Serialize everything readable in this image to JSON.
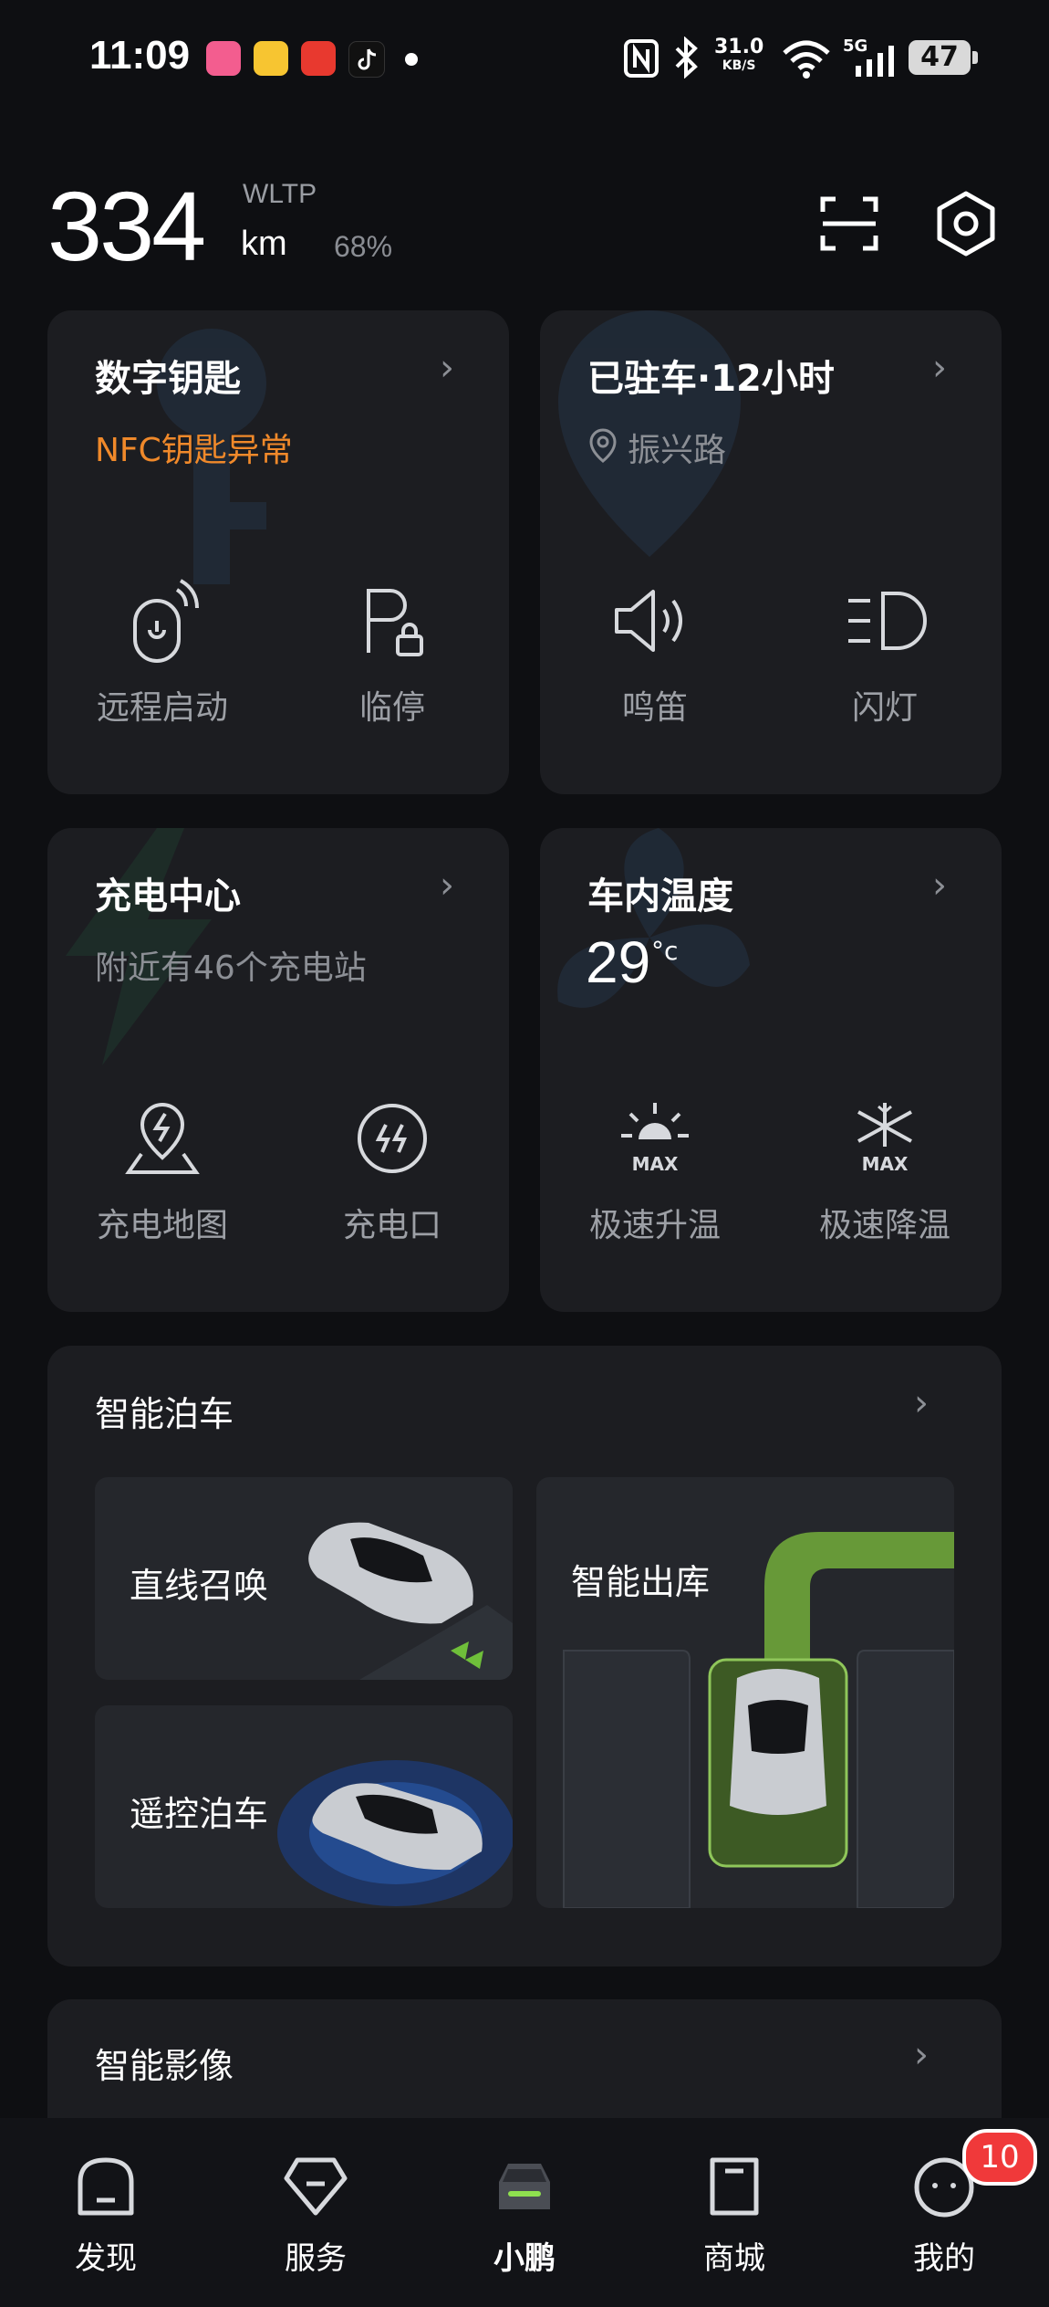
{
  "status_bar": {
    "time": "11:09",
    "net_speed_value": "31.0",
    "net_speed_unit": "KB/S",
    "network": "5G",
    "battery": "47"
  },
  "header": {
    "range_value": "334",
    "range_standard": "WLTP",
    "range_unit": "km",
    "battery_percent": "68%"
  },
  "digital_key": {
    "title": "数字钥匙",
    "subtitle": "NFC钥匙异常",
    "subtitle_color": "#f0892a",
    "actions": [
      {
        "label": "远程启动",
        "icon": "remote-start-icon"
      },
      {
        "label": "临停",
        "icon": "parking-lock-icon"
      }
    ]
  },
  "parked": {
    "title": "已驻车·12小时",
    "location": "振兴路",
    "actions": [
      {
        "label": "鸣笛",
        "icon": "horn-icon"
      },
      {
        "label": "闪灯",
        "icon": "headlight-icon"
      }
    ]
  },
  "charging": {
    "title": "充电中心",
    "subtitle": "附近有46个充电站",
    "actions": [
      {
        "label": "充电地图",
        "icon": "charging-map-icon"
      },
      {
        "label": "充电口",
        "icon": "charging-port-icon"
      }
    ]
  },
  "climate": {
    "title": "车内温度",
    "temperature": "29",
    "unit": "°c",
    "actions": [
      {
        "label": "极速升温",
        "icon": "max-heat-icon"
      },
      {
        "label": "极速降温",
        "icon": "max-cool-icon"
      }
    ]
  },
  "smart_parking": {
    "title": "智能泊车",
    "tiles": [
      {
        "label": "直线召唤"
      },
      {
        "label": "遥控泊车"
      },
      {
        "label": "智能出库"
      }
    ]
  },
  "smart_imaging": {
    "title": "智能影像"
  },
  "nav": {
    "items": [
      {
        "label": "发现"
      },
      {
        "label": "服务"
      },
      {
        "label": "小鹏"
      },
      {
        "label": "商城"
      },
      {
        "label": "我的"
      }
    ],
    "active_index": 2,
    "badge": "10"
  }
}
